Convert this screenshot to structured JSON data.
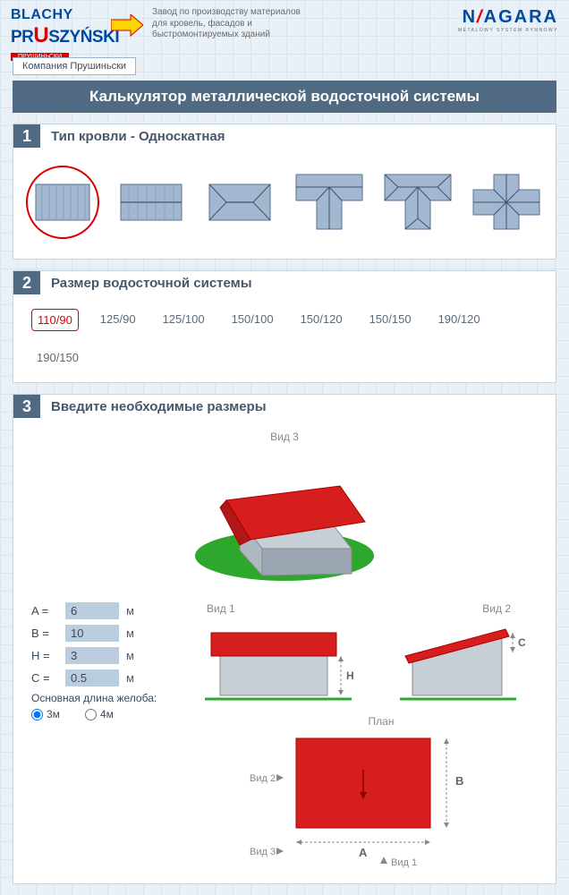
{
  "header": {
    "logo_line1": "BLACHY",
    "logo_line2_pre": "PR",
    "logo_line2_u": "U",
    "logo_line2_post": "SZYŃSKI",
    "logo_sub": "ПРУШИНЬСКИ",
    "description": "Завод по производству материалов\nдля кровель, фасадов и\nбыстромонтируемых зданий",
    "right_pre": "N",
    "right_slash": "/",
    "right_post": "AGARA",
    "right_sub": "METALOWY SYSTEM RYNNOWY",
    "tab": "Компания Прушиньски"
  },
  "title": "Калькулятор металлической водосточной системы",
  "step1": {
    "num": "1",
    "title": "Тип кровли - Односкатная"
  },
  "step2": {
    "num": "2",
    "title": "Размер водосточной системы",
    "sizes": [
      "110/90",
      "125/90",
      "125/100",
      "150/100",
      "150/120",
      "150/150",
      "190/120",
      "190/150"
    ],
    "selected": 0
  },
  "step3": {
    "num": "3",
    "title": "Введите необходимые размеры",
    "view3d": "Вид 3",
    "view1": "Вид 1",
    "view2": "Вид 2",
    "plan": "План",
    "inputs": {
      "A_label": "A =",
      "A": "6",
      "B_label": "B =",
      "B": "10",
      "H_label": "H =",
      "H": "3",
      "C_label": "C =",
      "C": "0.5",
      "unit": "м"
    },
    "gutter_label": "Основная длина желоба:",
    "radio_3m": "3м",
    "radio_4m": "4м",
    "dim_H": "H",
    "dim_C": "C",
    "dim_A": "A",
    "dim_B": "B"
  }
}
